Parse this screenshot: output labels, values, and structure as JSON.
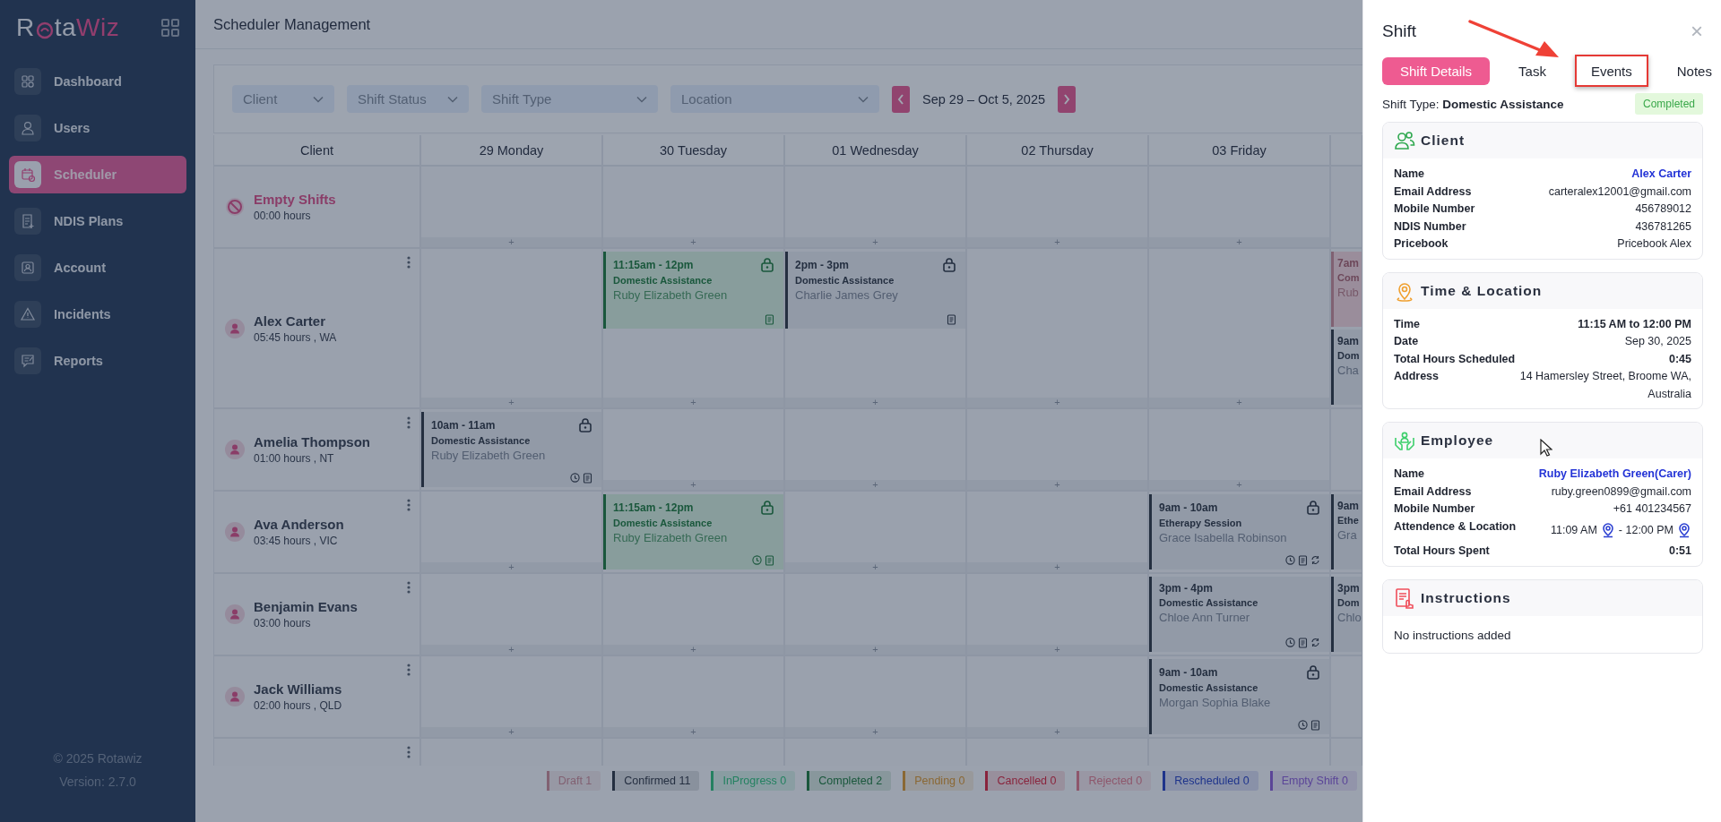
{
  "sidebar": {
    "logo": {
      "start": "R",
      "middle": "ta",
      "end": "Wiz"
    },
    "items": [
      {
        "label": "Dashboard",
        "selected": false
      },
      {
        "label": "Users",
        "selected": false
      },
      {
        "label": "Scheduler",
        "selected": true
      },
      {
        "label": "NDIS Plans",
        "selected": false
      },
      {
        "label": "Account",
        "selected": false
      },
      {
        "label": "Incidents",
        "selected": false
      },
      {
        "label": "Reports",
        "selected": false
      }
    ],
    "footer": [
      "© 2025 Rotawiz",
      "Version: 2.7.0"
    ]
  },
  "header": {
    "title": "Scheduler Management"
  },
  "filters": [
    {
      "placeholder": "Client"
    },
    {
      "placeholder": "Shift Status"
    },
    {
      "placeholder": "Shift Type"
    },
    {
      "placeholder": "Location"
    }
  ],
  "week": {
    "range": "Sep 29 – Oct 5, 2025"
  },
  "table": {
    "client_header": "Client",
    "days": [
      "29 Monday",
      "30 Tuesday",
      "01 Wednesday",
      "02 Thursday",
      "03 Friday"
    ],
    "rows": [
      {
        "kind": "empty",
        "name": "Empty Shifts",
        "hours": "00:00 hours",
        "cells": [
          {
            "add": "+"
          },
          {
            "add": "+"
          },
          {
            "add": "+"
          },
          {
            "add": "+"
          },
          {
            "add": "+"
          },
          {}
        ]
      },
      {
        "kind": "client",
        "name": "Alex Carter",
        "hours": "05:45 hours , WA",
        "cells": [
          {
            "add": "+"
          },
          {
            "add": "+",
            "shifts": [
              {
                "time": "11:15am - 12pm",
                "type": "Domestic Assistance",
                "employee": "Ruby Elizabeth Green",
                "kind": "completed",
                "locked": true,
                "clock": false,
                "notes": true,
                "repeat": false
              }
            ]
          },
          {
            "add": "+",
            "shifts": [
              {
                "time": "2pm - 3pm",
                "type": "Domestic Assistance",
                "employee": "Charlie James Grey",
                "kind": "confirmed",
                "locked": true,
                "clock": false,
                "notes": true,
                "repeat": false
              }
            ]
          },
          {
            "add": "+"
          },
          {
            "add": "+"
          },
          {
            "shifts": [
              {
                "time": "7am",
                "type": "Com",
                "employee": "Rub",
                "kind": "draft",
                "locked": false,
                "clock": false,
                "notes": false,
                "repeat": false
              },
              {
                "time": "9am",
                "type": "Dom",
                "employee": "Cha",
                "kind": "confirmed",
                "locked": false,
                "clock": false,
                "notes": false,
                "repeat": false
              }
            ]
          }
        ]
      },
      {
        "kind": "client",
        "name": "Amelia Thompson",
        "hours": "01:00 hours , NT",
        "cells": [
          {
            "shifts": [
              {
                "time": "10am - 11am",
                "type": "Domestic Assistance",
                "employee": "Ruby Elizabeth Green",
                "kind": "confirmed",
                "locked": true,
                "clock": true,
                "notes": true,
                "repeat": false
              }
            ]
          },
          {
            "add": "+"
          },
          {
            "add": "+"
          },
          {
            "add": "+"
          },
          {
            "add": "+"
          },
          {}
        ]
      },
      {
        "kind": "client",
        "name": "Ava Anderson",
        "hours": "03:45 hours , VIC",
        "cells": [
          {
            "add": "+"
          },
          {
            "shifts": [
              {
                "time": "11:15am - 12pm",
                "type": "Domestic Assistance",
                "employee": "Ruby Elizabeth Green",
                "kind": "completed",
                "locked": true,
                "clock": true,
                "notes": true,
                "repeat": false
              }
            ]
          },
          {
            "add": "+"
          },
          {
            "add": "+"
          },
          {
            "shifts": [
              {
                "time": "9am - 10am",
                "type": "Etherapy Session",
                "employee": "Grace Isabella Robinson",
                "kind": "confirmed",
                "locked": true,
                "clock": true,
                "notes": true,
                "repeat": true
              }
            ]
          },
          {
            "shifts": [
              {
                "time": "9am",
                "type": "Ethe",
                "employee": "Gra",
                "kind": "confirmed",
                "locked": false,
                "clock": false,
                "notes": false,
                "repeat": false
              }
            ]
          }
        ]
      },
      {
        "kind": "client",
        "name": "Benjamin Evans",
        "hours": "03:00 hours",
        "cells": [
          {
            "add": "+"
          },
          {
            "add": "+"
          },
          {
            "add": "+"
          },
          {
            "add": "+"
          },
          {
            "shifts": [
              {
                "time": "3pm - 4pm",
                "type": "Domestic Assistance",
                "employee": "Chloe Ann Turner",
                "kind": "confirmed",
                "locked": false,
                "clock": true,
                "notes": true,
                "repeat": true
              }
            ]
          },
          {
            "shifts": [
              {
                "time": "3pm",
                "type": "Dom",
                "employee": "Chlo",
                "kind": "confirmed",
                "locked": false,
                "clock": false,
                "notes": false,
                "repeat": false
              }
            ]
          }
        ]
      },
      {
        "kind": "client",
        "name": "Jack Williams",
        "hours": "02:00 hours , QLD",
        "cells": [
          {
            "add": "+"
          },
          {
            "add": "+"
          },
          {
            "add": "+"
          },
          {
            "add": "+"
          },
          {
            "shifts": [
              {
                "time": "9am - 10am",
                "type": "Domestic Assistance",
                "employee": "Morgan Sophia Blake",
                "kind": "confirmed",
                "locked": true,
                "clock": true,
                "notes": true,
                "repeat": false
              }
            ]
          },
          {}
        ]
      },
      {
        "kind": "cut",
        "cells": [
          {},
          {},
          {},
          {},
          {},
          {}
        ]
      }
    ]
  },
  "legend": [
    {
      "label": "Draft 1",
      "color": "#816172"
    },
    {
      "label": "Confirmed 11",
      "color": "#242f41"
    },
    {
      "label": "InProgress 0",
      "color": "#248161"
    },
    {
      "label": "Completed 2",
      "color": "#1a583c"
    },
    {
      "label": "Pending 0",
      "color": "#8a6834"
    },
    {
      "label": "Cancelled 0",
      "color": "#89253d"
    },
    {
      "label": "Rejected 0",
      "color": "#8e576c"
    },
    {
      "label": "Rescheduled 0",
      "color": "#1e348b"
    },
    {
      "label": "Empty Shift 0",
      "color": "#5b4598"
    }
  ],
  "drawer": {
    "title": "Shift",
    "close": "×",
    "tabs": [
      {
        "label": "Shift Details",
        "selected": true,
        "highlighted": false
      },
      {
        "label": "Task",
        "selected": false,
        "highlighted": false
      },
      {
        "label": "Events",
        "selected": false,
        "highlighted": true
      },
      {
        "label": "Notes",
        "selected": false,
        "highlighted": false
      }
    ],
    "shift_type": "Shift Type: **Domestic Assistance**",
    "status": "Completed",
    "sections": [
      {
        "title": "Client",
        "rows": [
          {
            "label": "Name",
            "value": "Alex Carter",
            "kind": "link"
          },
          {
            "label": "Email Address",
            "value": "carteralex12001@gmail.com",
            "kind": "plain"
          },
          {
            "label": "Mobile Number",
            "value": "456789012",
            "kind": "plain"
          },
          {
            "label": "NDIS Number",
            "value": "436781265",
            "kind": "plain"
          },
          {
            "label": "Pricebook",
            "value": "Pricebook Alex",
            "kind": "plain"
          }
        ]
      },
      {
        "title": "Time & Location",
        "rows": [
          {
            "label": "Time",
            "value": "11:15 AM to 12:00 PM",
            "kind": "strong"
          },
          {
            "label": "Date",
            "value": "Sep 30, 2025",
            "kind": "plain"
          },
          {
            "label": "Total Hours Scheduled",
            "value": "0:45",
            "kind": "strong"
          },
          {
            "label": "Address",
            "value": "14 Hamersley Street, Broome WA, Australia",
            "kind": "plain"
          }
        ]
      },
      {
        "title": "Employee",
        "rows": [
          {
            "label": "Name",
            "value": "Ruby Elizabeth Green(Carer)",
            "kind": "link"
          },
          {
            "label": "Email Address",
            "value": "ruby.green0899@gmail.com",
            "kind": "plain"
          },
          {
            "label": "Mobile Number",
            "value": "+61 401234567",
            "kind": "plain"
          },
          {
            "label": "Attendence & Location",
            "values": [
              "11:09 AM",
              "- 12:00 PM"
            ],
            "kind": "attendance"
          },
          {
            "label": "Total Hours Spent",
            "value": "0:51",
            "kind": "strong"
          }
        ]
      },
      {
        "title": "Instructions",
        "note": "No instructions added"
      }
    ]
  }
}
